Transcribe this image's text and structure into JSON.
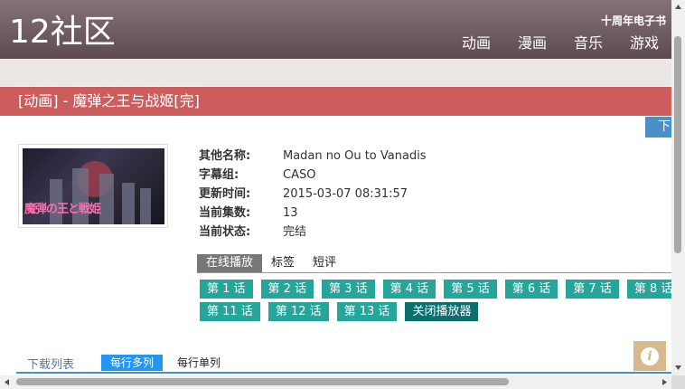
{
  "header": {
    "logo": "12社区",
    "top_link": "十周年电子书",
    "nav": [
      "动画",
      "漫画",
      "音乐",
      "游戏"
    ]
  },
  "title": "[动画] - 魔弹之王与战姬[完]",
  "download_button": "下",
  "info": [
    {
      "label": "其他名称:",
      "value": "Madan no Ou to Vanadis"
    },
    {
      "label": "字幕组:",
      "value": "CASO"
    },
    {
      "label": "更新时间:",
      "value": "2015-03-07 08:31:57"
    },
    {
      "label": "当前集数:",
      "value": "13"
    },
    {
      "label": "当前状态:",
      "value": "完结"
    }
  ],
  "tabs": [
    "在线播放",
    "标签",
    "短评"
  ],
  "episodes_row1": [
    "第 1 话",
    "第 2 话",
    "第 3 话",
    "第 4 话",
    "第 5 话",
    "第 6 话",
    "第 7 话",
    "第 8 话"
  ],
  "episodes_row2": [
    "第 11 话",
    "第 12 话",
    "第 13 话"
  ],
  "close_player": "关闭播放器",
  "download_list": {
    "label": "下载列表",
    "option_multi": "每行多列",
    "option_single": "每行单列"
  },
  "poster": {
    "logo_text": "魔弾の王と戦姫"
  },
  "icons": {
    "info": "info-icon"
  },
  "colors": {
    "header": "#6e5b63",
    "title_bar": "#cd5c5c",
    "episode": "#26a69a",
    "close": "#0d6e6e",
    "accent_blue": "#2196f3"
  }
}
